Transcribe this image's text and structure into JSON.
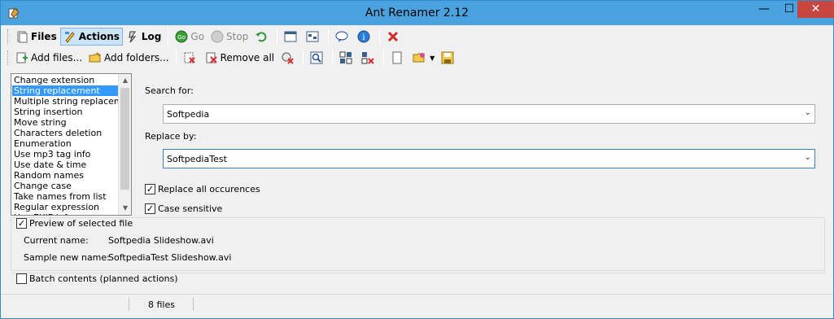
{
  "window": {
    "title": "Ant Renamer 2.12"
  },
  "titlebar_buttons": {
    "minimize": "—",
    "maximize": "☐",
    "close": "✕"
  },
  "toolbar1": {
    "files": "Files",
    "actions": "Actions",
    "log": "Log",
    "go": "Go",
    "stop": "Stop"
  },
  "toolbar2": {
    "add_files": "Add files...",
    "add_folders": "Add folders...",
    "remove_all": "Remove all"
  },
  "actions_list": {
    "items": [
      "Change extension",
      "String replacement",
      "Multiple string replacement",
      "String insertion",
      "Move string",
      "Characters deletion",
      "Enumeration",
      "Use mp3 tag info",
      "Use date & time",
      "Random names",
      "Change case",
      "Take names from list",
      "Regular expression",
      "Use EXIF info"
    ],
    "selected_index": 1
  },
  "form": {
    "search_label": "Search for:",
    "search_value": "Softpedia",
    "replace_label": "Replace by:",
    "replace_value": "SoftpediaTest",
    "replace_all_label": "Replace all occurences",
    "replace_all_checked": true,
    "case_sensitive_label": "Case sensitive",
    "case_sensitive_checked": true
  },
  "preview": {
    "checkbox_label": "Preview of selected file",
    "checked": true,
    "current_name_label": "Current name:",
    "current_name_value": "Softpedia Slideshow.avi",
    "sample_new_name_label": "Sample new name:",
    "sample_new_name_value": "SoftpediaTest Slideshow.avi"
  },
  "batch": {
    "checkbox_label": "Batch contents (planned actions)",
    "checked": false
  },
  "status": {
    "file_count": "8 files"
  },
  "colors": {
    "titlebar": "#4aa3df",
    "selection": "#3399ff",
    "close": "#c7463f"
  }
}
